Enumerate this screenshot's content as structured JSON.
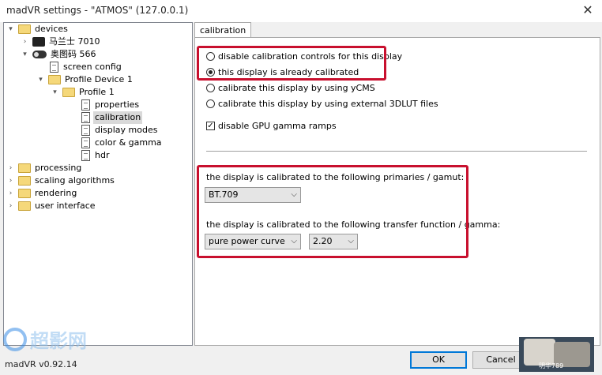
{
  "window": {
    "title": "madVR settings - \"ATMOS\" (127.0.0.1)",
    "close_glyph": "✕"
  },
  "tree": {
    "items": [
      {
        "label": "devices",
        "icon": "folder-icon"
      },
      {
        "label": "马兰士 7010",
        "icon": "monitor-icon"
      },
      {
        "label": "奥图码 566",
        "icon": "projector-icon"
      },
      {
        "label": "screen config",
        "icon": "page-icon"
      },
      {
        "label": "Profile Device 1",
        "icon": "folder-icon"
      },
      {
        "label": "Profile 1",
        "icon": "folder-icon"
      },
      {
        "label": "properties",
        "icon": "page-icon"
      },
      {
        "label": "calibration",
        "icon": "page-icon"
      },
      {
        "label": "display modes",
        "icon": "page-icon"
      },
      {
        "label": "color & gamma",
        "icon": "page-icon"
      },
      {
        "label": "hdr",
        "icon": "page-icon"
      },
      {
        "label": "processing",
        "icon": "folder-icon"
      },
      {
        "label": "scaling algorithms",
        "icon": "folder-icon"
      },
      {
        "label": "rendering",
        "icon": "folder-icon"
      },
      {
        "label": "user interface",
        "icon": "folder-icon"
      }
    ],
    "selected": "calibration"
  },
  "tab": {
    "label": "calibration"
  },
  "calibration": {
    "radio_disable": "disable calibration controls for this display",
    "radio_calibrated": "this display is already calibrated",
    "radio_ycms": "calibrate this display by using yCMS",
    "radio_3dlut": "calibrate this display by using external 3DLUT files",
    "selected_option": "this display is already calibrated",
    "gpu_gamma_label": "disable GPU gamma ramps",
    "gpu_gamma_checked": true,
    "primaries_label": "the display is calibrated to the following primaries / gamut:",
    "primaries_value": "BT.709",
    "transfer_label": "the display is calibrated to the following transfer function / gamma:",
    "transfer_value": "pure power curve",
    "gamma_value": "2.20"
  },
  "buttons": {
    "ok": "OK",
    "cancel": "Cancel"
  },
  "version": "madVR v0.92.14",
  "watermark": {
    "text": "超影网"
  },
  "thumbnail": {
    "caption": "明华789"
  },
  "colors": {
    "highlight": "#c8102e",
    "accent": "#0078d7"
  }
}
